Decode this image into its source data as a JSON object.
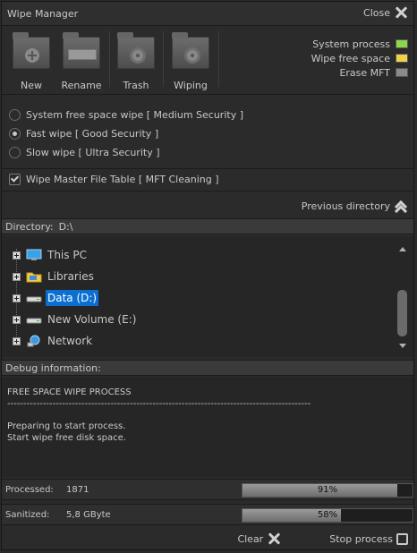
{
  "window": {
    "title": "Wipe Manager",
    "close_label": "Close"
  },
  "toolbar": {
    "buttons": [
      {
        "label": "New"
      },
      {
        "label": "Rename"
      },
      {
        "label": "Trash"
      },
      {
        "label": "Wiping"
      }
    ]
  },
  "status": [
    {
      "label": "System process",
      "color": "#8bd84a"
    },
    {
      "label": "Wipe free space",
      "color": "#f0d24a"
    },
    {
      "label": "Erase MFT",
      "color": "#8a8a8a"
    }
  ],
  "wipe_modes": [
    {
      "label": "System free space wipe [ Medium Security ]",
      "selected": false
    },
    {
      "label": "Fast wipe [ Good Security ]",
      "selected": true
    },
    {
      "label": "Slow wipe [ Ultra Security ]",
      "selected": false
    }
  ],
  "mft": {
    "label": "Wipe Master File Table [ MFT Cleaning ]",
    "checked": true
  },
  "nav": {
    "previous_directory": "Previous directory"
  },
  "directory": {
    "label": "Directory:",
    "path": "D:\\"
  },
  "tree": [
    {
      "label": "This PC",
      "icon": "computer-icon"
    },
    {
      "label": "Libraries",
      "icon": "libraries-folder-icon"
    },
    {
      "label": "Data (D:)",
      "icon": "drive-icon",
      "selected": true
    },
    {
      "label": "New Volume (E:)",
      "icon": "drive-icon"
    },
    {
      "label": "Network",
      "icon": "network-icon"
    }
  ],
  "debug": {
    "header": "Debug information:",
    "title": "FREE SPACE WIPE PROCESS",
    "separator": "----------------------------------------------------------------------------------------------",
    "lines": [
      "Preparing to start process.",
      "Start wipe free disk space."
    ]
  },
  "progress": [
    {
      "label": "Processed:",
      "value": "1871",
      "percent": 91,
      "percent_text": "91%"
    },
    {
      "label": "Sanitized:",
      "value": "5,8 GByte",
      "percent": 58,
      "percent_text": "58%"
    }
  ],
  "actions": {
    "clear_label": "Clear",
    "stop_label": "Stop process"
  }
}
